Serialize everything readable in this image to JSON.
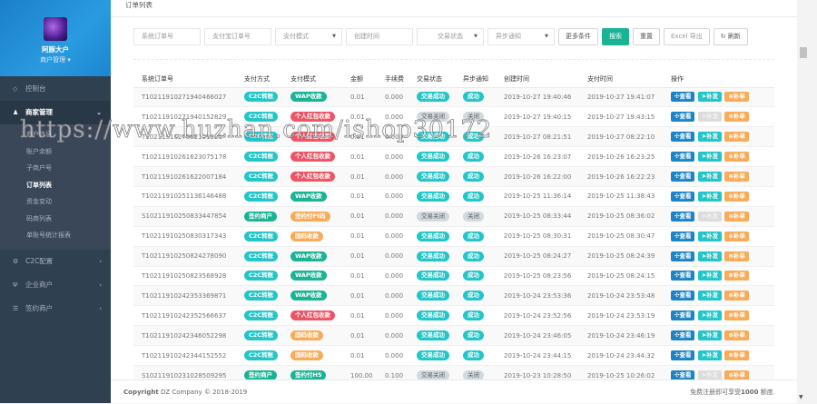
{
  "sidebar": {
    "user_name": "阿豚大户",
    "user_role": "商户管理 ▾",
    "items": [
      {
        "label": "控制台",
        "icon": "diamond-icon"
      },
      {
        "label": "商家管理",
        "icon": "user-icon",
        "sub": [
          "商户信息",
          "账户余额",
          "子商户号",
          "订单列表",
          "资金变动",
          "码商列表",
          "单账号统计报表"
        ]
      },
      {
        "label": "C2C配置",
        "icon": "cogs-icon"
      },
      {
        "label": "企业商户",
        "icon": "cutlery-icon"
      },
      {
        "label": "签约商户",
        "icon": "list-icon"
      }
    ]
  },
  "page": {
    "title": "订单列表"
  },
  "filters": {
    "order_no": "系统订单号",
    "alipay_no": "支付宝订单号",
    "pay_mode": "支付模式",
    "create_time": "创建时间",
    "trade_status": "交易状态",
    "notify": "异步通知",
    "more": "更多条件",
    "search": "搜索",
    "reset": "重置",
    "export": "Excel 导出",
    "refresh": "刷新"
  },
  "table": {
    "headers": [
      "系统订单号",
      "支付方式",
      "支付模式",
      "金额",
      "手续费",
      "交易状态",
      "异步通知",
      "创建时间",
      "支付时间",
      "操作"
    ],
    "ops": {
      "view": "查看",
      "resend": "补发",
      "supplement": "补单"
    },
    "rows": [
      {
        "no": "T1021191027194046​6027",
        "method": "C2C转账",
        "mc": "teal",
        "mode": "WAP收款",
        "mdc": "green",
        "amount": "0.01",
        "fee": "0.000",
        "status": "交易成功",
        "sc": "teal",
        "notify": "成功",
        "nc": "teal",
        "created": "2019-10-27 19:40:46",
        "paid": "2019-10-27 19:41:07",
        "resend_enabled": true
      },
      {
        "no": "T102119102719401528​29",
        "method": "C2C转账",
        "mc": "teal",
        "mode": "个人红包收款",
        "mdc": "red",
        "amount": "0.01",
        "fee": "0.000",
        "status": "交易关闭",
        "sc": "grey",
        "notify": "关闭",
        "nc": "grey",
        "created": "2019-10-27 19:40:15",
        "paid": "2019-10-27 19:43:15",
        "resend_enabled": false
      },
      {
        "no": "T1021191027082151​321",
        "method": "C2C转账",
        "mc": "teal",
        "mode": "个人红包收款",
        "mdc": "red",
        "amount": "0.01",
        "fee": "0.000",
        "status": "交易成功",
        "sc": "teal",
        "notify": "成功",
        "nc": "teal",
        "created": "2019-10-27 08:21:51",
        "paid": "2019-10-27 08:22:10",
        "resend_enabled": true
      },
      {
        "no": "T102119102616230751​78",
        "method": "C2C转账",
        "mc": "teal",
        "mode": "个人红包收款",
        "mdc": "red",
        "amount": "0.01",
        "fee": "0.000",
        "status": "交易成功",
        "sc": "teal",
        "notify": "成功",
        "nc": "teal",
        "created": "2019-10-26 16:23:07",
        "paid": "2019-10-26 16:23:25",
        "resend_enabled": true
      },
      {
        "no": "T102119102616220071​84",
        "method": "C2C转账",
        "mc": "teal",
        "mode": "个人红包收款",
        "mdc": "red",
        "amount": "0.01",
        "fee": "0.000",
        "status": "交易成功",
        "sc": "teal",
        "notify": "成功",
        "nc": "teal",
        "created": "2019-10-26 16:22:00",
        "paid": "2019-10-26 16:22:23",
        "resend_enabled": true
      },
      {
        "no": "T102119102511361464​88",
        "method": "C2C转账",
        "mc": "teal",
        "mode": "WAP收款",
        "mdc": "green",
        "amount": "0.01",
        "fee": "0.000",
        "status": "交易成功",
        "sc": "teal",
        "notify": "成功",
        "nc": "teal",
        "created": "2019-10-25 11:36:14",
        "paid": "2019-10-25 11:38:43",
        "resend_enabled": true
      },
      {
        "no": "S102119102508334478​54",
        "method": "签约商户",
        "mc": "green",
        "mode": "签约付Ft码",
        "mdc": "orange",
        "amount": "0.01",
        "fee": "0.000",
        "status": "交易关闭",
        "sc": "grey",
        "notify": "关闭",
        "nc": "grey",
        "created": "2019-10-25 08:33:44",
        "paid": "2019-10-25 08:36:02",
        "resend_enabled": false
      },
      {
        "no": "T102119102508303173​43",
        "method": "C2C转账",
        "mc": "teal",
        "mode": "固码收款",
        "mdc": "orange",
        "amount": "0.01",
        "fee": "0.000",
        "status": "交易成功",
        "sc": "teal",
        "notify": "成功",
        "nc": "teal",
        "created": "2019-10-25 08:30:31",
        "paid": "2019-10-25 08:30:47",
        "resend_enabled": true
      },
      {
        "no": "T102119102508242780​90",
        "method": "C2C转账",
        "mc": "teal",
        "mode": "WAP收款",
        "mdc": "green",
        "amount": "0.01",
        "fee": "0.000",
        "status": "交易成功",
        "sc": "teal",
        "notify": "成功",
        "nc": "teal",
        "created": "2019-10-25 08:24:27",
        "paid": "2019-10-25 08:24:39",
        "resend_enabled": true
      },
      {
        "no": "T102119102508235689​28",
        "method": "C2C转账",
        "mc": "teal",
        "mode": "WAP收款",
        "mdc": "green",
        "amount": "0.01",
        "fee": "0.000",
        "status": "交易成功",
        "sc": "teal",
        "notify": "成功",
        "nc": "teal",
        "created": "2019-10-25 08:23:56",
        "paid": "2019-10-25 08:24:15",
        "resend_enabled": true
      },
      {
        "no": "T102119102423533698​71",
        "method": "C2C转账",
        "mc": "teal",
        "mode": "WAP收款",
        "mdc": "green",
        "amount": "0.01",
        "fee": "0.000",
        "status": "交易成功",
        "sc": "teal",
        "notify": "成功",
        "nc": "teal",
        "created": "2019-10-24 23:53:36",
        "paid": "2019-10-24 23:53:48",
        "resend_enabled": true
      },
      {
        "no": "T102119102423525666​37",
        "method": "C2C转账",
        "mc": "teal",
        "mode": "个人红包收款",
        "mdc": "red",
        "amount": "0.01",
        "fee": "0.000",
        "status": "交易成功",
        "sc": "teal",
        "notify": "成功",
        "nc": "teal",
        "created": "2019-10-24 23:52:56",
        "paid": "2019-10-24 23:53:19",
        "resend_enabled": true
      },
      {
        "no": "T102119102423460522​98",
        "method": "C2C转账",
        "mc": "teal",
        "mode": "固码收款",
        "mdc": "orange",
        "amount": "0.01",
        "fee": "0.000",
        "status": "交易成功",
        "sc": "teal",
        "notify": "成功",
        "nc": "teal",
        "created": "2019-10-24 23:46:05",
        "paid": "2019-10-24 23:46:19",
        "resend_enabled": true
      },
      {
        "no": "T102119102423441525​52",
        "method": "C2C转账",
        "mc": "teal",
        "mode": "固码收款",
        "mdc": "orange",
        "amount": "0.01",
        "fee": "0.000",
        "status": "交易成功",
        "sc": "teal",
        "notify": "成功",
        "nc": "teal",
        "created": "2019-10-24 23:44:15",
        "paid": "2019-10-24 23:44:32",
        "resend_enabled": true
      },
      {
        "no": "S102119102310285092​95",
        "method": "签约商户",
        "mc": "green",
        "mode": "签约付H5",
        "mdc": "green",
        "amount": "100.00",
        "fee": "0.100",
        "status": "交易关闭",
        "sc": "grey",
        "notify": "关闭",
        "nc": "grey",
        "created": "2019-10-23 10:28:50",
        "paid": "2019-10-25 10:26:02",
        "resend_enabled": false
      }
    ]
  },
  "footer": {
    "copyright_bold": "Copyright",
    "copyright": " DZ Company © 2018-2019",
    "notice_pre": "免费注册即可享受",
    "notice_num": "1000",
    "notice_post": " 额度."
  },
  "watermark": "https://www.huzhan.com/ishop30172"
}
